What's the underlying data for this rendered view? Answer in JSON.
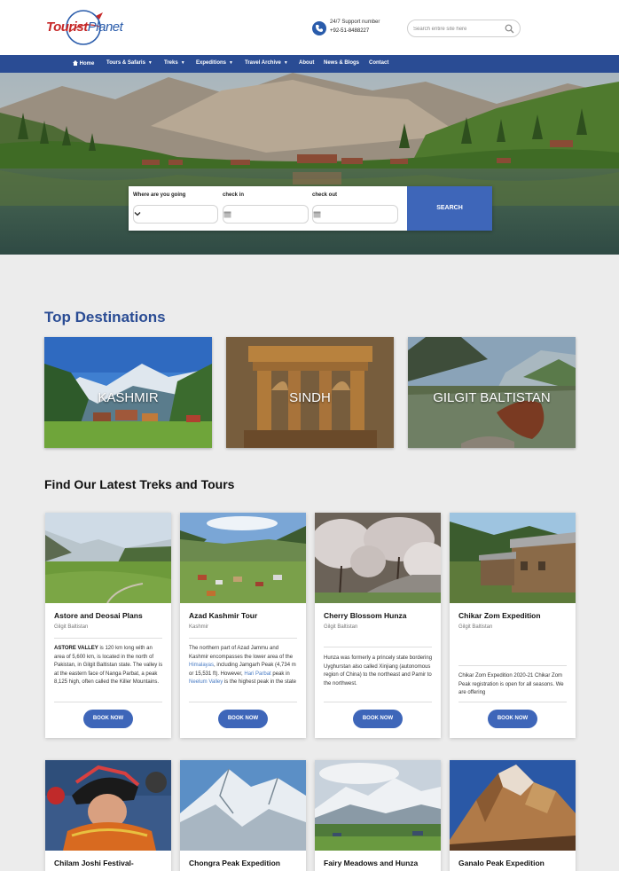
{
  "header": {
    "logo": {
      "part1": "Tourist",
      "part2": "Planet"
    },
    "support_label": "24/7 Support number",
    "support_phone": "+92-51-8488227",
    "search_placeholder": "Search entire site here"
  },
  "nav": {
    "items": [
      {
        "label": "Home",
        "icon": "home-icon",
        "dropdown": false
      },
      {
        "label": "Tours & Safaris",
        "dropdown": true
      },
      {
        "label": "Treks",
        "dropdown": true
      },
      {
        "label": "Expeditions",
        "dropdown": true
      },
      {
        "label": "Travel Archive",
        "dropdown": true
      },
      {
        "label": "About",
        "dropdown": false
      },
      {
        "label": "News & Blogs",
        "dropdown": false
      },
      {
        "label": "Contact",
        "dropdown": false
      }
    ]
  },
  "search_panel": {
    "destination_label": "Where are you going",
    "destination_value": "",
    "checkin_label": "check in",
    "checkout_label": "check out",
    "search_label": "SEARCH"
  },
  "top_destinations": {
    "title": "Top Destinations",
    "items": [
      {
        "label": "KASHMIR"
      },
      {
        "label": "SINDH"
      },
      {
        "label": "GILGIT BALTISTAN"
      }
    ]
  },
  "tours": {
    "title": "Find Our Latest Treks and Tours",
    "book_label": "BOOK NOW",
    "cards": [
      {
        "title": "Astore and Deosai Plans",
        "region": "Gilgit Baltistan",
        "desc_bold": "ASTORE VALLEY",
        "desc": " is 120 km long with an area of 5,600 km, is located in the north of Pakistan, in Gilgit Baltistan state. The valley is at the eastern face of Nanga Parbat, a peak 8,125 high, often called the Killer Mountains."
      },
      {
        "title": "Azad Kashmir Tour",
        "region": "Kashmir",
        "desc_a": "The northern part of Azad Jammu and Kashmir encompasses the lower area of the ",
        "link1": "Himalayas",
        "desc_b": ", including Jamgarh Peak (4,734 m or 15,531 ft). However, ",
        "link2": "Hari Parbat",
        "desc_c": " peak in ",
        "link3": "Neelum Valley",
        "desc_d": " is the highest peak in the state"
      },
      {
        "title": "Cherry Blossom Hunza",
        "region": "Gilgit Baltistan",
        "desc": "Hunza was formerly a princely state bordering Uyghurstan also called Xinjiang (autonomous region of China) to the northeast and Pamir to the northwest."
      },
      {
        "title": "Chikar Zom Expedition",
        "region": "Gilgit Baltistan",
        "desc": "Chikar Zom Expedition 2020-21 Chikar Zom Peak registration is open for all seasons. We are offering"
      }
    ],
    "cards_row2": [
      {
        "title": "Chilam Joshi Festival-"
      },
      {
        "title": "Chongra Peak Expedition"
      },
      {
        "title": "Fairy Meadows and Hunza"
      },
      {
        "title": "Ganalo Peak Expedition"
      }
    ]
  },
  "colors": {
    "brand_blue": "#2a4c94",
    "button_blue": "#3e66b9",
    "logo_red": "#c62828",
    "page_bg": "#ececec"
  }
}
